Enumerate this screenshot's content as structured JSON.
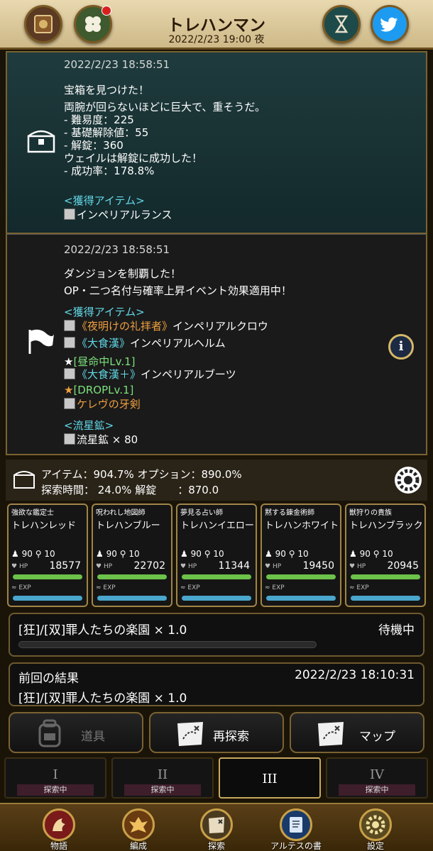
{
  "header": {
    "title": "トレハンマン",
    "datetime": "2022/2/23 19:00 夜"
  },
  "log1": {
    "timestamp": "2022/2/23 18:58:51",
    "lines": [
      "宝箱を見つけた！",
      "両腕が回らないほどに巨大で、重そうだ。",
      "- 難易度：225",
      "- 基礎解除値：55",
      "- 解錠：360",
      "ウェイルは解錠に成功した！",
      "- 成功率：178.8%"
    ],
    "items_header": "<獲得アイテム>",
    "items": [
      "インペリアルランス"
    ]
  },
  "log2": {
    "timestamp": "2022/2/23 18:58:51",
    "lines": [
      "ダンジョンを制覇した！",
      "OP・二つ名付与確率上昇イベント効果適用中！"
    ],
    "items_header": "<獲得アイテム>",
    "items": [
      {
        "epithet": "《夜明けの礼拝者》",
        "name": "インペリアルクロウ"
      },
      {
        "epithet": "《大食漢》",
        "name": "インペリアルヘルム"
      },
      {
        "star": "★",
        "option": "[昼命中Lv.1]"
      },
      {
        "epithet": "《大食漢＋》",
        "name": "インペリアルブーツ"
      },
      {
        "star": "★",
        "option": "[DROPLv.1]"
      },
      {
        "name": "ケレヴの牙剣"
      }
    ],
    "meteor_header": "<流星鉱>",
    "meteor": "流星鉱 × 80"
  },
  "stats": {
    "line1": "アイテム：904.7% オプション：890.0%",
    "line2": "探索時間： 24.0% 解錠　　：870.0"
  },
  "characters": [
    {
      "title": "強欲な鑑定士",
      "name": "トレハンレッド",
      "lv": "90",
      "stat": "10",
      "hp": "18577"
    },
    {
      "title": "呪われし地図師",
      "name": "トレハンブルー",
      "lv": "90",
      "stat": "10",
      "hp": "22702"
    },
    {
      "title": "夢見る占い師",
      "name": "トレハンイエロー",
      "lv": "90",
      "stat": "10",
      "hp": "11344"
    },
    {
      "title": "黙する錬金術師",
      "name": "トレハンホワイト",
      "lv": "90",
      "stat": "10",
      "hp": "19450"
    },
    {
      "title": "獣狩りの貴族",
      "name": "トレハンブラック",
      "lv": "90",
      "stat": "10",
      "hp": "20945"
    }
  ],
  "labels": {
    "hp": "HP",
    "exp": "EXP"
  },
  "current": {
    "dungeon": "[狂]/[双]罪人たちの楽園 × 1.0",
    "status": "待機中",
    "progress": 0
  },
  "previous": {
    "header": "前回の結果",
    "timestamp": "2022/2/23 18:10:31",
    "dungeon": "[狂]/[双]罪人たちの楽園 × 1.0"
  },
  "actions": {
    "tools": "道具",
    "reexplore": "再探索",
    "map": "マップ"
  },
  "tabs": [
    {
      "num": "I",
      "status": "探索中"
    },
    {
      "num": "II",
      "status": "探索中"
    },
    {
      "num": "III",
      "status": ""
    },
    {
      "num": "IV",
      "status": "探索中"
    }
  ],
  "nav": [
    "物語",
    "編成",
    "探索",
    "アルテスの書",
    "設定"
  ],
  "colors": {
    "cyan": "#62d8e8",
    "orange": "#f0a040",
    "green": "#7be07b",
    "hp": "#6cc24a",
    "exp": "#4aa6cc"
  }
}
